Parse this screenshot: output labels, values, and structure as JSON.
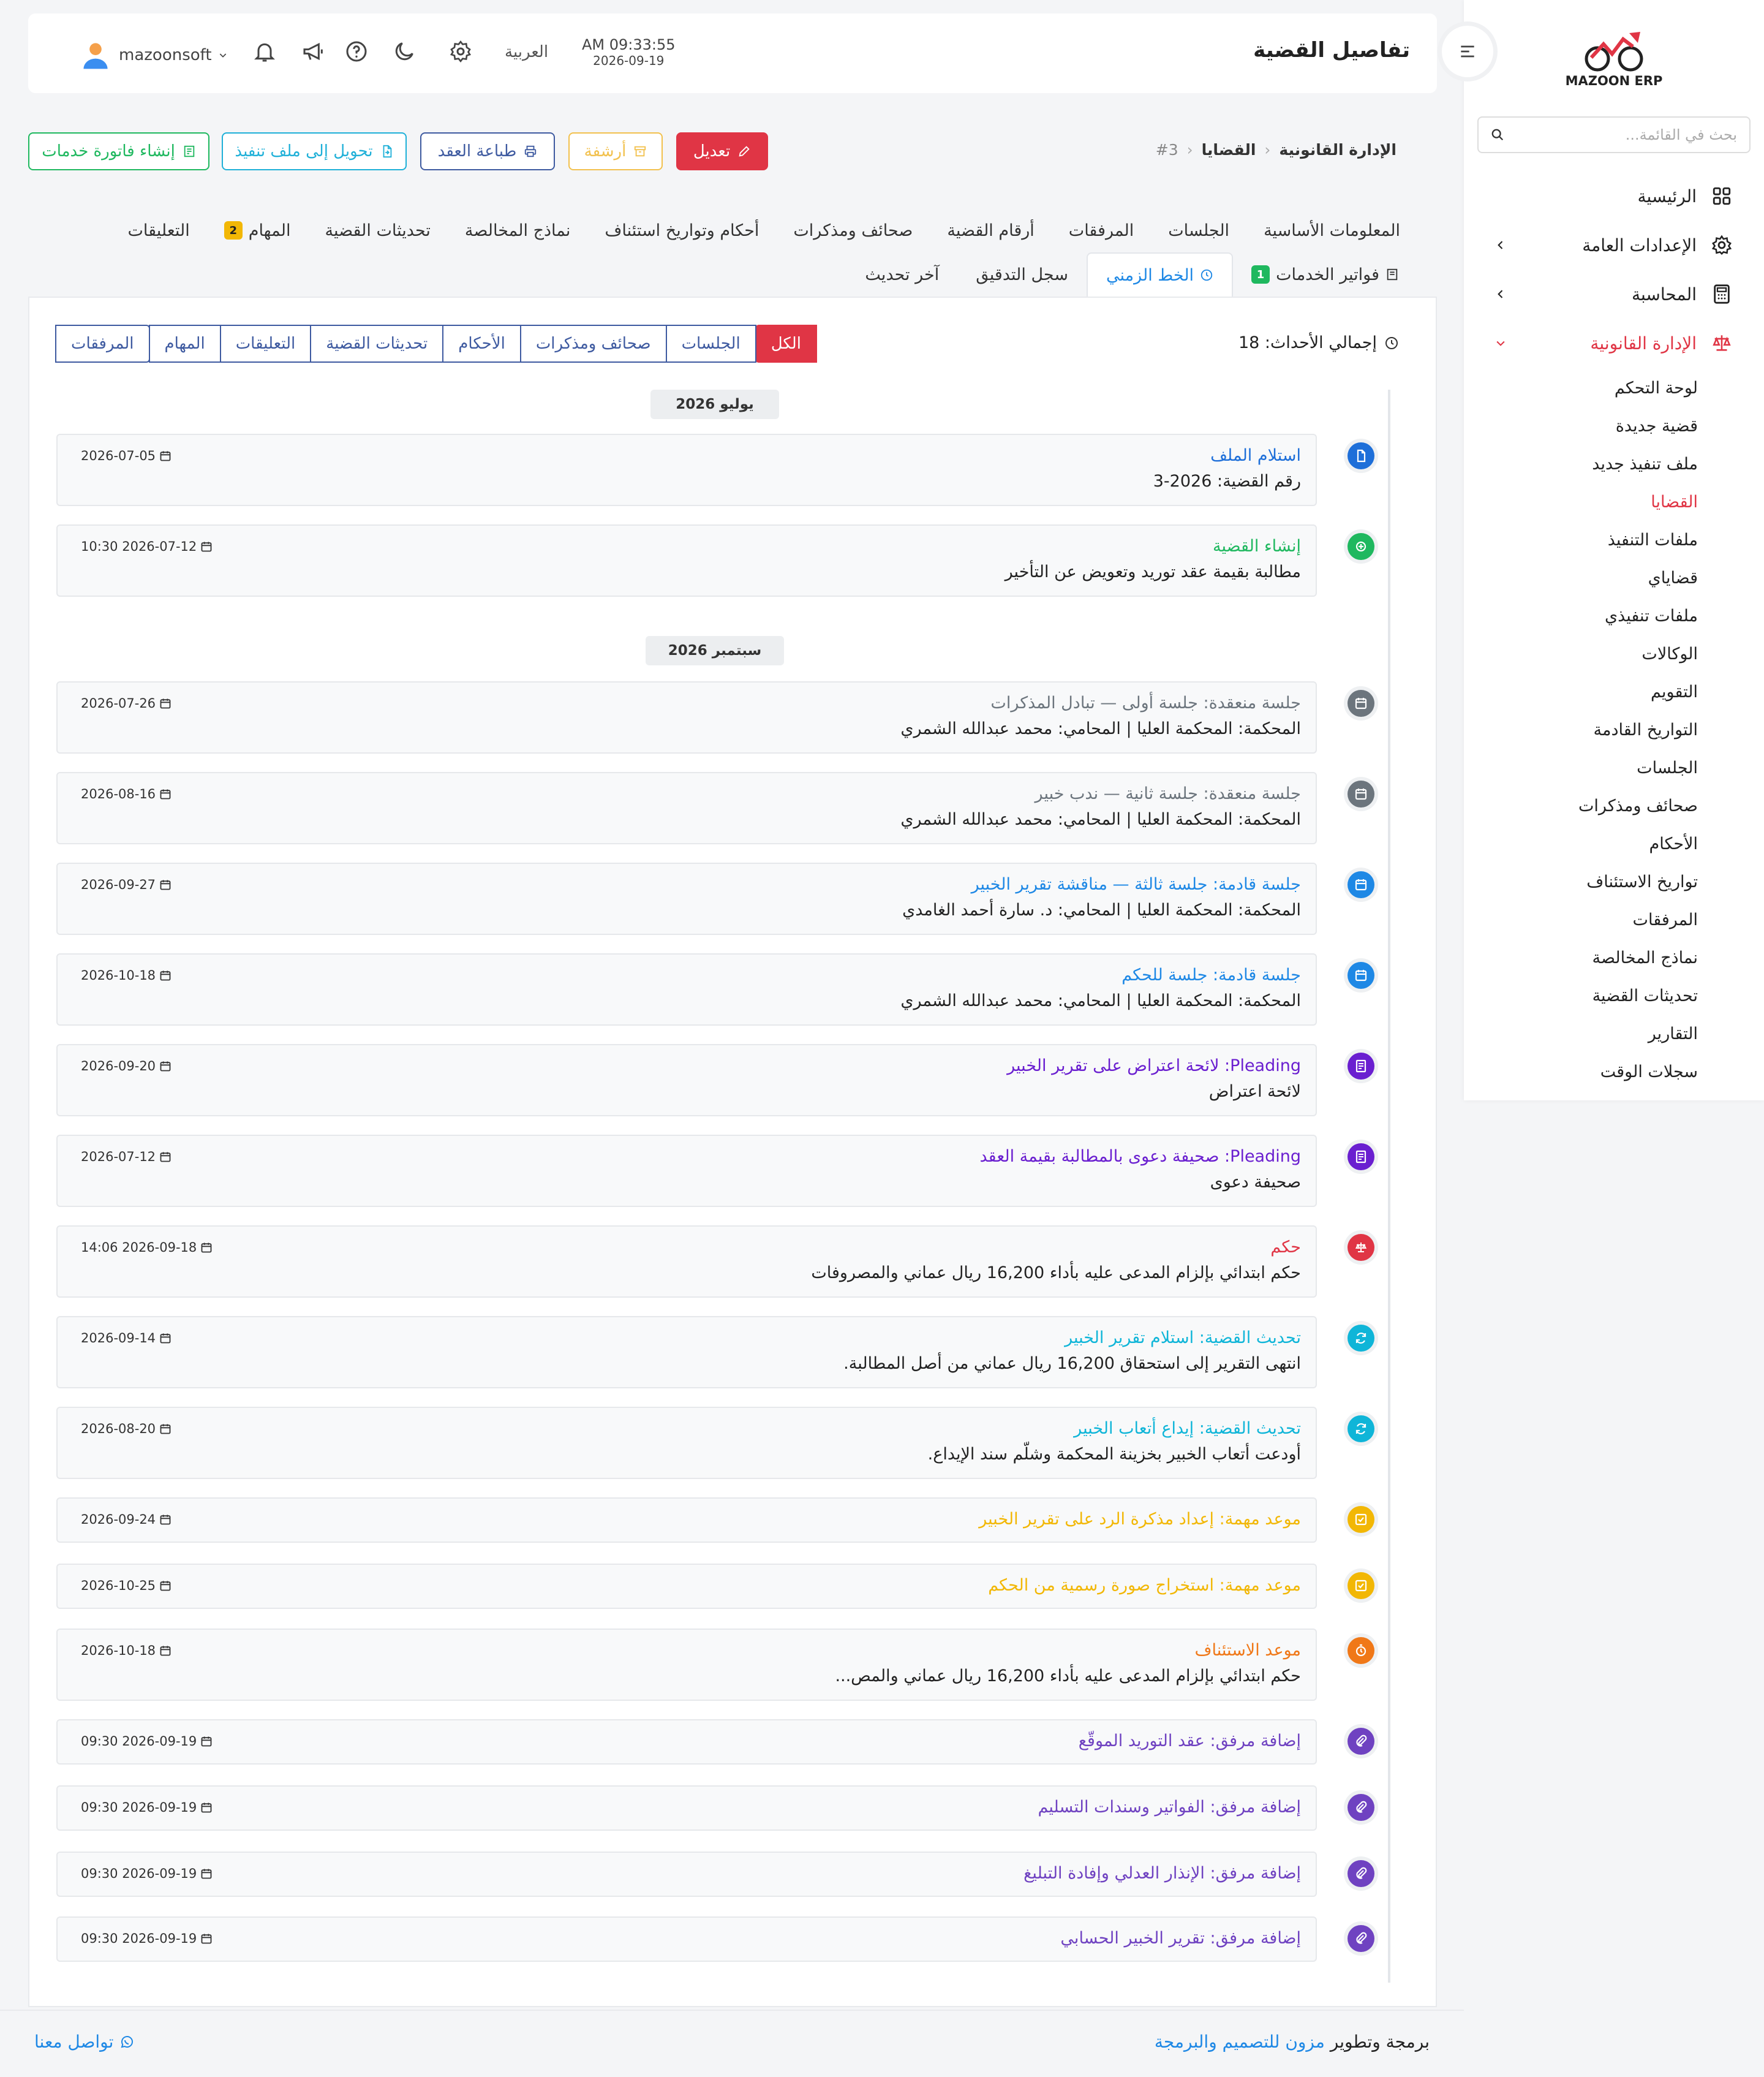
{
  "app": {
    "logo_text": "MAZOON ERP"
  },
  "sidebar": {
    "search_placeholder": "بحث في القائمة...",
    "items": [
      {
        "label": "الرئيسية"
      },
      {
        "label": "الإعدادات العامة"
      },
      {
        "label": "المحاسبة"
      },
      {
        "label": "الإدارة القانونية"
      }
    ],
    "sub_items": [
      "لوحة التحكم",
      "قضية جديدة",
      "ملف تنفيذ جديد",
      "القضايا",
      "ملفات التنفيذ",
      "قضاياي",
      "ملفات تنفيذي",
      "الوكالات",
      "التقويم",
      "التواريخ القادمة",
      "الجلسات",
      "صحائف ومذكرات",
      "الأحكام",
      "تواريخ الاستئناف",
      "المرفقات",
      "نماذج المخالصة",
      "تحديثات القضية",
      "التقارير",
      "سجلات الوقت"
    ]
  },
  "header": {
    "title": "تفاصيل القضية",
    "time": "AM 09:33:55",
    "date": "2026-09-19",
    "language": "العربية",
    "username": "mazoonsoft"
  },
  "breadcrumb": {
    "root": "الإدارة القانونية",
    "section": "القضايا",
    "current": "#3"
  },
  "actions": {
    "edit": "تعديل",
    "archive": "أرشفة",
    "print_contract": "طباعة العقد",
    "convert_execution": "تحويل إلى ملف تنفيذ",
    "create_invoice": "إنشاء فاتورة خدمات"
  },
  "tabs_row1": [
    {
      "label": "المعلومات الأساسية"
    },
    {
      "label": "الجلسات"
    },
    {
      "label": "المرفقات"
    },
    {
      "label": "أرقام القضية"
    },
    {
      "label": "صحائف ومذكرات"
    },
    {
      "label": "أحكام وتواريخ استئناف"
    },
    {
      "label": "نماذج المخالصة"
    },
    {
      "label": "تحديثات القضية"
    },
    {
      "label": "المهام",
      "badge": "2"
    },
    {
      "label": "التعليقات"
    }
  ],
  "tabs_row2": [
    {
      "label": "فواتير الخدمات",
      "badge": "1"
    },
    {
      "label": "الخط الزمني"
    },
    {
      "label": "سجل التدقيق"
    },
    {
      "label": "آخر تحديث"
    }
  ],
  "timeline": {
    "total_label": "إجمالي الأحداث: 18",
    "filters": [
      "الكل",
      "الجلسات",
      "صحائف ومذكرات",
      "الأحكام",
      "تحديثات القضية",
      "التعليقات",
      "المهام",
      "المرفقات"
    ],
    "months": [
      "يوليو 2026",
      "سبتمبر 2026"
    ],
    "events": [
      {
        "title": "استلام الملف",
        "sub": "رقم القضية: 2026-3",
        "date": "2026-07-05",
        "color": "#1e6fd9",
        "icon": "file-icon"
      },
      {
        "title": "إنشاء القضية",
        "sub": "مطالبة بقيمة عقد توريد وتعويض عن التأخير",
        "date": "2026-07-12 10:30",
        "color": "#1fb85f",
        "icon": "plus-circle-icon"
      },
      {
        "title": "جلسة منعقدة: جلسة أولى — تبادل المذكرات",
        "sub": "المحكمة: المحكمة العليا | المحامي: محمد عبدالله الشمري",
        "date": "2026-07-26",
        "color": "#6c757d",
        "icon": "calendar-icon"
      },
      {
        "title": "جلسة منعقدة: جلسة ثانية — ندب خبير",
        "sub": "المحكمة: المحكمة العليا | المحامي: محمد عبدالله الشمري",
        "date": "2026-08-16",
        "color": "#6c757d",
        "icon": "calendar-icon"
      },
      {
        "title": "جلسة قادمة: جلسة ثالثة — مناقشة تقرير الخبير",
        "sub": "المحكمة: المحكمة العليا | المحامي: د. سارة أحمد الغامدي",
        "date": "2026-09-27",
        "color": "#1e88e5",
        "icon": "calendar-icon"
      },
      {
        "title": "جلسة قادمة: جلسة للحكم",
        "sub": "المحكمة: المحكمة العليا | المحامي: محمد عبدالله الشمري",
        "date": "2026-10-18",
        "color": "#1e88e5",
        "icon": "calendar-icon"
      },
      {
        "title": "Pleading: لائحة اعتراض على تقرير الخبير",
        "sub": "لائحة اعتراض",
        "date": "2026-09-20",
        "color": "#6a1fd0",
        "icon": "document-icon"
      },
      {
        "title": "Pleading: صحيفة دعوى بالمطالبة بقيمة العقد",
        "sub": "صحيفة دعوى",
        "date": "2026-07-12",
        "color": "#6a1fd0",
        "icon": "document-icon"
      },
      {
        "title": "حكم",
        "sub": "حكم ابتدائي بإلزام المدعى عليه بأداء 16,200 ريال عماني والمصروفات",
        "date": "2026-09-18 14:06",
        "color": "#e03545",
        "icon": "scale-icon"
      },
      {
        "title": "تحديث القضية: استلام تقرير الخبير",
        "sub": "انتهى التقرير إلى استحقاق 16,200 ريال عماني من أصل المطالبة.",
        "date": "2026-09-14",
        "color": "#0fb5d8",
        "icon": "refresh-icon"
      },
      {
        "title": "تحديث القضية: إيداع أتعاب الخبير",
        "sub": "أودعت أتعاب الخبير بخزينة المحكمة وشلّم سند الإيداع.",
        "date": "2026-08-20",
        "color": "#0fb5d8",
        "icon": "refresh-icon"
      },
      {
        "title": "موعد مهمة: إعداد مذكرة الرد على تقرير الخبير",
        "sub": "",
        "date": "2026-09-24",
        "color": "#f2b705",
        "icon": "task-icon"
      },
      {
        "title": "موعد مهمة: استخراج صورة رسمية من الحكم",
        "sub": "",
        "date": "2026-10-25",
        "color": "#f2b705",
        "icon": "task-icon"
      },
      {
        "title": "موعد الاستئناف",
        "sub": "حكم ابتدائي بإلزام المدعى عليه بأداء 16,200 ريال عماني والمص...",
        "date": "2026-10-18",
        "color": "#f07818",
        "icon": "stopwatch-icon"
      },
      {
        "title": "إضافة مرفق: عقد التوريد الموقّع",
        "sub": "",
        "date": "2026-09-19 09:30",
        "color": "#6f42c1",
        "icon": "paperclip-icon"
      },
      {
        "title": "إضافة مرفق: الفواتير وسندات التسليم",
        "sub": "",
        "date": "2026-09-19 09:30",
        "color": "#6f42c1",
        "icon": "paperclip-icon"
      },
      {
        "title": "إضافة مرفق: الإنذار العدلي وإفادة التبليغ",
        "sub": "",
        "date": "2026-09-19 09:30",
        "color": "#6f42c1",
        "icon": "paperclip-icon"
      },
      {
        "title": "إضافة مرفق: تقرير الخبير الحسابي",
        "sub": "",
        "date": "2026-09-19 09:30",
        "color": "#6f42c1",
        "icon": "paperclip-icon"
      }
    ]
  },
  "footer": {
    "prefix": "برمجة وتطوير",
    "company": "مزون للتصميم والبرمجة",
    "contact": "تواصل معنا"
  }
}
